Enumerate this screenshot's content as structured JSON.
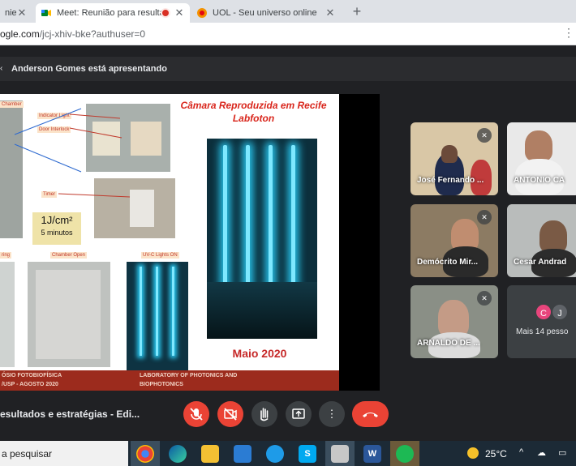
{
  "browser": {
    "tabs": [
      {
        "title": "nie",
        "active": false
      },
      {
        "title": "Meet: Reunião para resultad",
        "active": true,
        "recording": true
      },
      {
        "title": "UOL - Seu universo online",
        "active": false
      }
    ],
    "close_glyph": "✕",
    "newtab_glyph": "+",
    "url_host": "ogle.com",
    "url_path": "/jcj-xhiv-bke?authuser=0"
  },
  "meet": {
    "presenter_text": "Anderson Gomes está apresentando",
    "meeting_title": "esultados e estratégias - Edi...",
    "slide": {
      "title": "Câmara Reproduzida em Recife Labfoton",
      "date": "Maio 2020",
      "labels": {
        "chamber": "Chamber",
        "indicator": "Indicator Light",
        "door": "Door Interlock",
        "timer": "Timer",
        "ring": "ring",
        "open": "Chamber Open",
        "uvc": "UV-C Lights ON"
      },
      "dose_value": "1J/cm²",
      "dose_time": "5 minutos",
      "footer_left_1": "ÓSIO FOTOBIOFÍSICA",
      "footer_left_2": "/USP - AGOSTO 2020",
      "footer_right_1": "LABORATORY OF PHOTONICS AND",
      "footer_right_2": "BIOPHOTONICS"
    },
    "participants": [
      {
        "name": "José Fernando ...",
        "muted": true
      },
      {
        "name": "ANTONIO CA",
        "muted": false
      },
      {
        "name": "Demócrito Mir...",
        "muted": true
      },
      {
        "name": "Cesar Andrad",
        "muted": false
      },
      {
        "name": "ARNALDO DE ...",
        "muted": true
      }
    ],
    "more": {
      "label": "Mais 14 pesso",
      "avatars": [
        "C",
        "J"
      ],
      "avatar_colors": [
        "#e8457c",
        "#5f6368"
      ]
    }
  },
  "taskbar": {
    "search_placeholder": "a pesquisar",
    "apps": [
      "chrome",
      "edge",
      "explorer",
      "store",
      "safari",
      "skype",
      "paint",
      "word",
      "spotify"
    ],
    "app_letters": {
      "skype": "S",
      "word": "W"
    },
    "temperature": "25°C",
    "tray_up": "^"
  }
}
